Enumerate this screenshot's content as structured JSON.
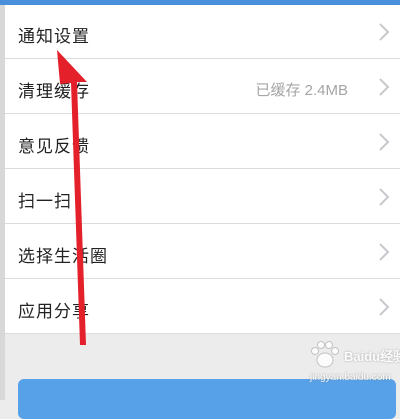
{
  "settings": {
    "items": [
      {
        "label": "通知设置",
        "value": ""
      },
      {
        "label": "清理缓存",
        "value": "已缓存 2.4MB"
      },
      {
        "label": "意见反馈",
        "value": ""
      },
      {
        "label": "扫一扫",
        "value": ""
      },
      {
        "label": "选择生活圈",
        "value": ""
      },
      {
        "label": "应用分享",
        "value": ""
      }
    ],
    "chevron_icon": "chevron-right-icon"
  },
  "logout": {
    "label": ""
  },
  "annotation": {
    "arrow_color": "#e4202a",
    "icon": "red-arrow-icon"
  },
  "watermark": {
    "logo_text": "Baidu经验",
    "url_text": "jingyan.baidu.com"
  },
  "colors": {
    "accent": "#56a1e8",
    "topbar": "#4a8fdc",
    "chevron": "#c7c7cc"
  }
}
